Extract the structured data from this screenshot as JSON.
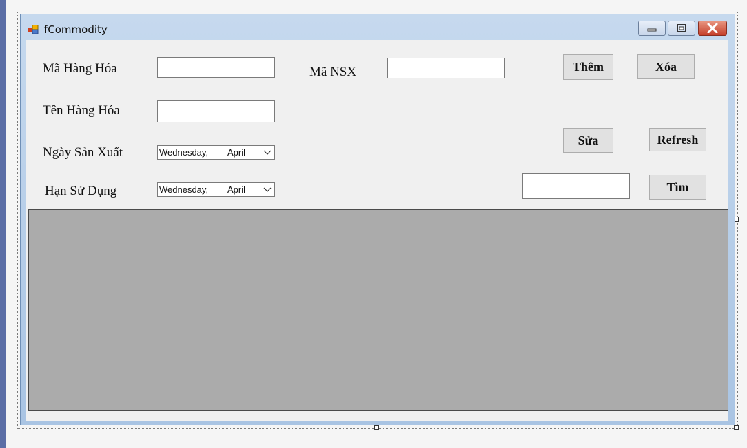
{
  "window": {
    "title": "fCommodity"
  },
  "labels": {
    "ma_hang_hoa": "Mã Hàng Hóa",
    "ma_nsx": "Mã NSX",
    "ten_hang_hoa": "Tên Hàng Hóa",
    "ngay_san_xuat": "Ngày Sản Xuất",
    "han_su_dung": "Hạn Sử Dụng"
  },
  "inputs": {
    "ma_hang_hoa": "",
    "ma_nsx": "",
    "ten_hang_hoa": "",
    "search": ""
  },
  "date_pickers": {
    "ngay_san_xuat": {
      "day": "Wednesday,",
      "month": "April"
    },
    "han_su_dung": {
      "day": "Wednesday,",
      "month": "April"
    }
  },
  "buttons": {
    "them": "Thêm",
    "xoa": "Xóa",
    "sua": "Sửa",
    "refresh": "Refresh",
    "tim": "Tìm"
  },
  "icons": [
    "app-icon",
    "minimize-icon",
    "maximize-icon",
    "close-icon",
    "chevron-down-icon"
  ],
  "colors": {
    "grid_bg": "#ababab",
    "titlebar": "#b9cfe8",
    "close_button": "#c5402b"
  }
}
